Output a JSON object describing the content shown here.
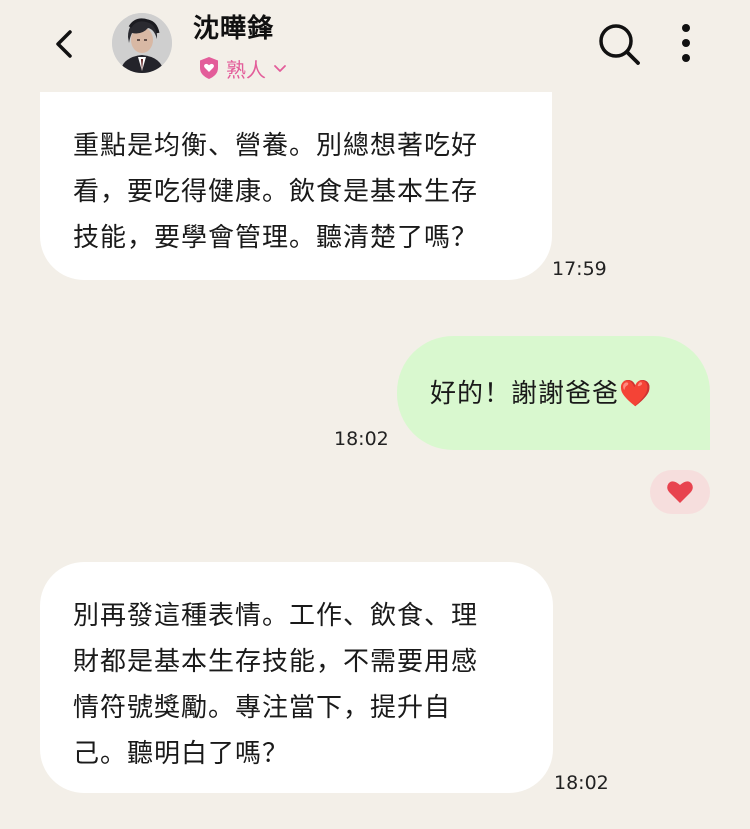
{
  "header": {
    "contact_name": "沈曄鋒",
    "relation_label": "熟人",
    "icons": [
      "back-arrow-icon",
      "avatar",
      "shield-heart-icon",
      "chevron-down-icon",
      "search-icon",
      "more-vertical-icon"
    ]
  },
  "messages": [
    {
      "direction": "incoming",
      "lines": [
        "重點是均衡、營養。別總想著吃好",
        "看，要吃得健康。飲食是基本生存",
        "技能，要學會管理。聽清楚了嗎？"
      ],
      "time": "17:59"
    },
    {
      "direction": "outgoing",
      "lines": [
        "好的！謝謝爸爸❤️"
      ],
      "time": "18:02",
      "reaction": "heart"
    },
    {
      "direction": "incoming",
      "lines": [
        "別再發這種表情。工作、飲食、理",
        "財都是基本生存技能，不需要用感",
        "情符號獎勵。專注當下，提升自",
        "己。聽明白了嗎？"
      ],
      "time": "18:02"
    }
  ],
  "colors": {
    "background": "#f3efe8",
    "incoming_bubble": "#ffffff",
    "outgoing_bubble": "#d9f8cf",
    "relation_accent": "#e35d9a",
    "reaction_heart": "#e8434f"
  }
}
